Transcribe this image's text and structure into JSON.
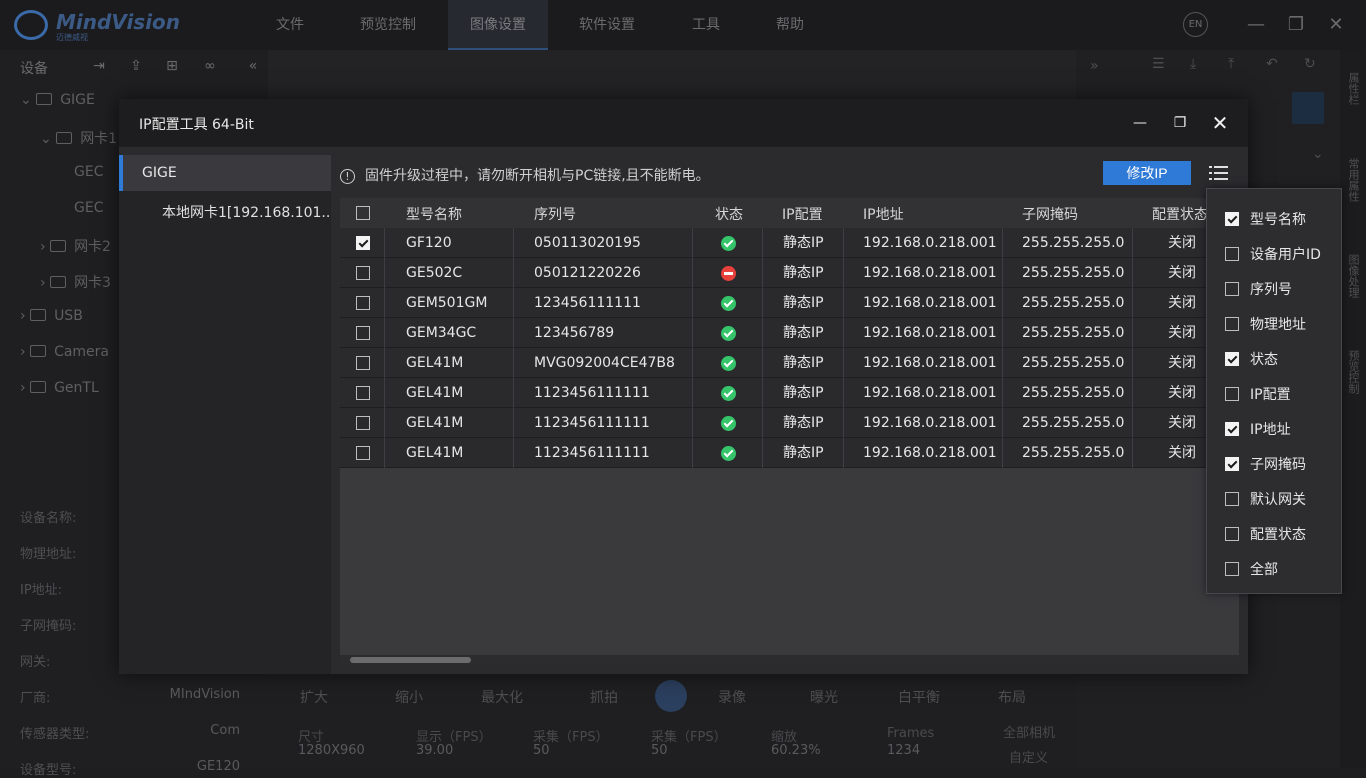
{
  "app": {
    "logo_text": "MindVision",
    "logo_sub": "迈德威视",
    "menu": [
      "文件",
      "预览控制",
      "图像设置",
      "软件设置",
      "工具",
      "帮助"
    ],
    "lang": "EN",
    "window_controls": [
      "—",
      "❐",
      "✕"
    ]
  },
  "left_panel": {
    "header": "设备",
    "tree": [
      "GIGE",
      "网卡1",
      "GEC",
      "GEC",
      "网卡2",
      "网卡3",
      "USB",
      "Camera",
      "GenTL"
    ],
    "props": [
      {
        "label": "设备名称:",
        "value": ""
      },
      {
        "label": "物理地址:",
        "value": ""
      },
      {
        "label": "IP地址:",
        "value": ""
      },
      {
        "label": "子网掩码:",
        "value": ""
      },
      {
        "label": "网关:",
        "value": ""
      },
      {
        "label": "厂商:",
        "value": "MIndVision"
      },
      {
        "label": "传感器类型:",
        "value": "Com"
      },
      {
        "label": "设备型号:",
        "value": "GE120"
      }
    ]
  },
  "right_strip": [
    "属性栏",
    "常用属性",
    "图像处理",
    "预览控制"
  ],
  "bottom_bar": {
    "tools": [
      "扩大",
      "缩小",
      "最大化",
      "抓拍",
      "录像",
      "曝光",
      "白平衡",
      "布局"
    ],
    "stats": [
      {
        "label": "尺寸",
        "value": "1280X960"
      },
      {
        "label": "显示（FPS）",
        "value": "39.00"
      },
      {
        "label": "采集（FPS）",
        "value": "50"
      },
      {
        "label": "采集（FPS）",
        "value": "50"
      },
      {
        "label": "缩放",
        "value": "60.23%"
      },
      {
        "label": "Frames",
        "value": "1234"
      }
    ],
    "right_labels": [
      "全部相机",
      "自定义"
    ]
  },
  "dialog": {
    "title": "IP配置工具 64-Bit",
    "controls": {
      "minimize": "—",
      "restore": "❐",
      "close": "✕"
    },
    "nav": {
      "root": "GIGE",
      "nic": "本地网卡1[192.168.101..."
    },
    "notice": "固件升级过程中，请勿断开相机与PC链接,且不能断电。",
    "notice_icon": "!",
    "modify_button": "修改IP",
    "columns": [
      "型号名称",
      "序列号",
      "状态",
      "IP配置",
      "IP地址",
      "子网掩码",
      "配置状态"
    ],
    "rows": [
      {
        "checked": true,
        "model": "GF120",
        "serial": "050113020195",
        "status": "ok",
        "ipcfg": "静态IP",
        "ip": "192.168.0.218.001",
        "mask": "255.255.255.0",
        "cfgstate": "关闭"
      },
      {
        "checked": false,
        "model": "GE502C",
        "serial": "050121220226",
        "status": "err",
        "ipcfg": "静态IP",
        "ip": "192.168.0.218.001",
        "mask": "255.255.255.0",
        "cfgstate": "关闭"
      },
      {
        "checked": false,
        "model": "GEM501GM",
        "serial": "123456111111",
        "status": "ok",
        "ipcfg": "静态IP",
        "ip": "192.168.0.218.001",
        "mask": "255.255.255.0",
        "cfgstate": "关闭"
      },
      {
        "checked": false,
        "model": "GEM34GC",
        "serial": "123456789",
        "status": "ok",
        "ipcfg": "静态IP",
        "ip": "192.168.0.218.001",
        "mask": "255.255.255.0",
        "cfgstate": "关闭"
      },
      {
        "checked": false,
        "model": "GEL41M",
        "serial": "MVG092004CE47B8",
        "status": "ok",
        "ipcfg": "静态IP",
        "ip": "192.168.0.218.001",
        "mask": "255.255.255.0",
        "cfgstate": "关闭"
      },
      {
        "checked": false,
        "model": "GEL41M",
        "serial": "1123456111111",
        "status": "ok",
        "ipcfg": "静态IP",
        "ip": "192.168.0.218.001",
        "mask": "255.255.255.0",
        "cfgstate": "关闭"
      },
      {
        "checked": false,
        "model": "GEL41M",
        "serial": "1123456111111",
        "status": "ok",
        "ipcfg": "静态IP",
        "ip": "192.168.0.218.001",
        "mask": "255.255.255.0",
        "cfgstate": "关闭"
      },
      {
        "checked": false,
        "model": "GEL41M",
        "serial": "1123456111111",
        "status": "ok",
        "ipcfg": "静态IP",
        "ip": "192.168.0.218.001",
        "mask": "255.255.255.0",
        "cfgstate": "关闭"
      }
    ],
    "column_options": [
      {
        "label": "型号名称",
        "checked": true
      },
      {
        "label": "设备用户ID",
        "checked": false
      },
      {
        "label": "序列号",
        "checked": false
      },
      {
        "label": "物理地址",
        "checked": false
      },
      {
        "label": "状态",
        "checked": true
      },
      {
        "label": "IP配置",
        "checked": false
      },
      {
        "label": "IP地址",
        "checked": true
      },
      {
        "label": "子网掩码",
        "checked": true
      },
      {
        "label": "默认网关",
        "checked": false
      },
      {
        "label": "配置状态",
        "checked": false
      },
      {
        "label": "全部",
        "checked": false
      }
    ],
    "colors": {
      "accent": "#2f7ad6",
      "ok": "#35c46a",
      "error": "#e8413b"
    }
  }
}
